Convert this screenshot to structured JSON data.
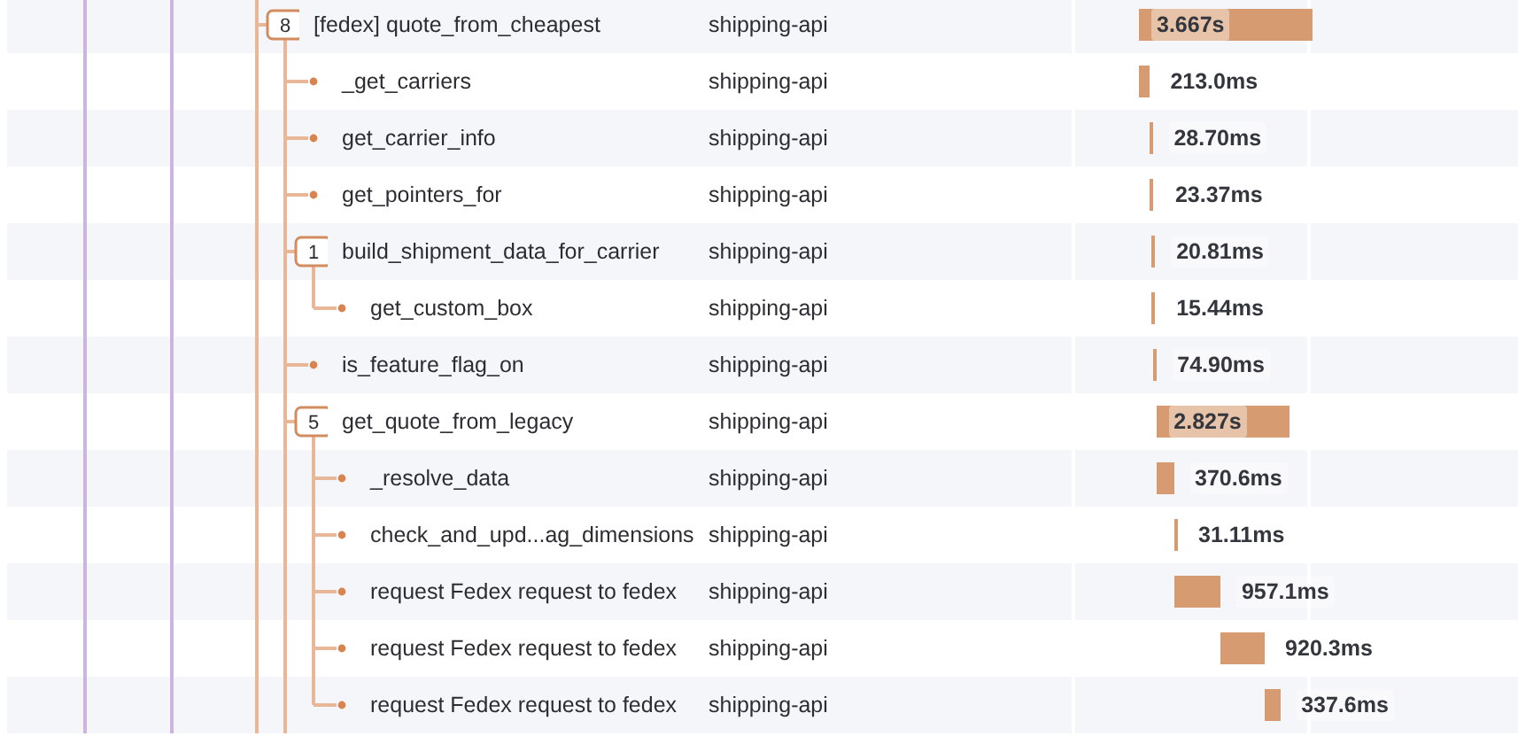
{
  "spans": [
    {
      "name": "[fedex] quote_from_cheapest",
      "service": "shipping-api",
      "duration": "3.667s",
      "child_count": "8",
      "children_cut_off": true,
      "children": [
        {
          "name": "_get_carriers",
          "service": "shipping-api",
          "duration": "213.0ms"
        },
        {
          "name": "get_carrier_info",
          "service": "shipping-api",
          "duration": "28.70ms"
        },
        {
          "name": "get_pointers_for",
          "service": "shipping-api",
          "duration": "23.37ms"
        },
        {
          "name": "build_shipment_data_for_carrier",
          "service": "shipping-api",
          "duration": "20.81ms",
          "child_count": "1",
          "children": [
            {
              "name": "get_custom_box",
              "service": "shipping-api",
              "duration": "15.44ms"
            }
          ]
        },
        {
          "name": "is_feature_flag_on",
          "service": "shipping-api",
          "duration": "74.90ms"
        },
        {
          "name": "get_quote_from_legacy",
          "service": "shipping-api",
          "duration": "2.827s",
          "child_count": "5",
          "children": [
            {
              "name": "_resolve_data",
              "service": "shipping-api",
              "duration": "370.6ms"
            },
            {
              "name": "check_and_upd...ag_dimensions",
              "service": "shipping-api",
              "duration": "31.11ms"
            },
            {
              "name": "request Fedex request to fedex",
              "service": "shipping-api",
              "duration": "957.1ms"
            },
            {
              "name": "request Fedex request to fedex",
              "service": "shipping-api",
              "duration": "920.3ms"
            },
            {
              "name": "request Fedex request to fedex",
              "service": "shipping-api",
              "duration": "337.6ms"
            }
          ]
        }
      ]
    }
  ]
}
